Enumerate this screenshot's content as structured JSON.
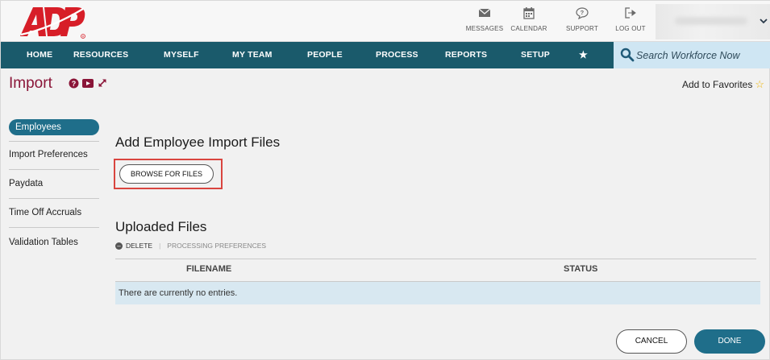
{
  "header": {
    "logo_text": "ADP",
    "utilities": [
      {
        "label": "MESSAGES",
        "icon": "envelope-icon"
      },
      {
        "label": "CALENDAR",
        "icon": "calendar-icon"
      },
      {
        "label": "SUPPORT",
        "icon": "support-bubble-icon"
      },
      {
        "label": "LOG OUT",
        "icon": "logout-icon"
      }
    ]
  },
  "nav": {
    "items": [
      {
        "label": "HOME"
      },
      {
        "label": "RESOURCES"
      },
      {
        "label": "MYSELF"
      },
      {
        "label": "MY TEAM"
      },
      {
        "label": "PEOPLE"
      },
      {
        "label": "PROCESS"
      },
      {
        "label": "REPORTS"
      },
      {
        "label": "SETUP"
      },
      {
        "label": "★"
      }
    ],
    "search_placeholder": "Search Workforce Now"
  },
  "page": {
    "title": "Import",
    "favorites_label": "Add to Favorites"
  },
  "sidebar": {
    "items": [
      {
        "label": "Employees",
        "active": true
      },
      {
        "label": "Import Preferences"
      },
      {
        "label": "Paydata"
      },
      {
        "label": "Time Off Accruals"
      },
      {
        "label": "Validation Tables"
      }
    ]
  },
  "main": {
    "add_heading": "Add Employee Import Files",
    "browse_label": "BROWSE FOR FILES",
    "uploaded_heading": "Uploaded Files",
    "delete_label": "DELETE",
    "processing_label": "PROCESSING PREFERENCES",
    "columns": [
      "FILENAME",
      "STATUS"
    ],
    "empty_message": "There are currently no entries."
  },
  "footer": {
    "cancel_label": "CANCEL",
    "done_label": "DONE"
  },
  "colors": {
    "brand_red": "#d71e28",
    "nav_teal": "#1a5a6b",
    "accent_blue": "#1f6e8a",
    "title_maroon": "#8a1538",
    "highlight_red": "#d9453f"
  }
}
